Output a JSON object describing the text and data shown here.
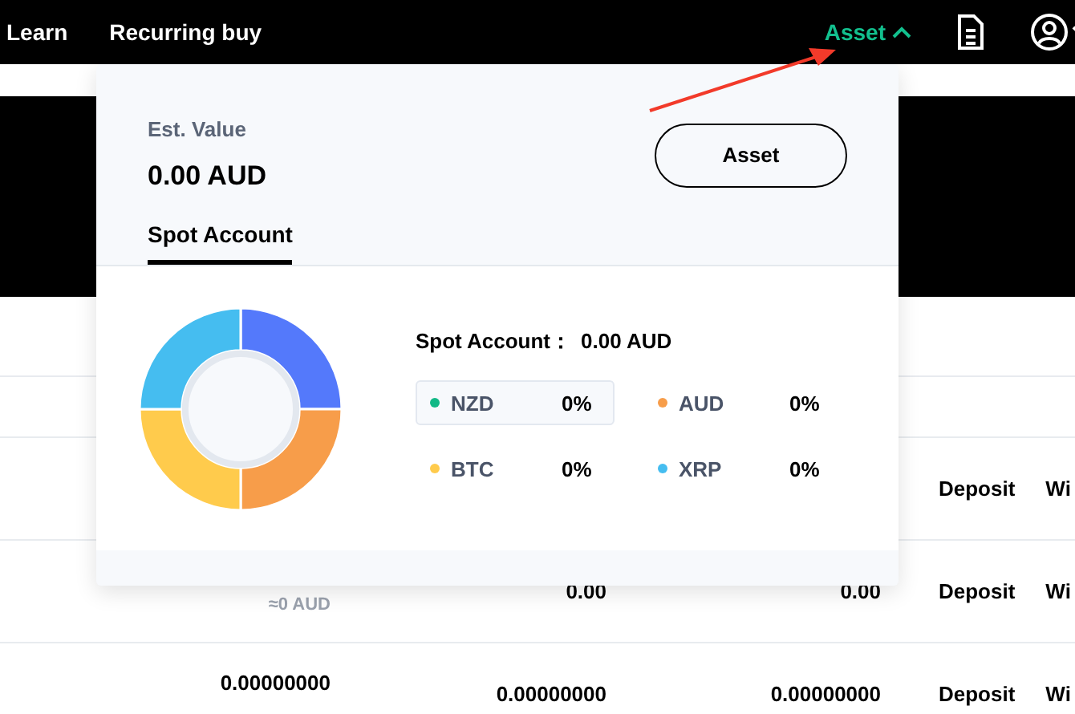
{
  "nav": {
    "items": [
      "Learn",
      "Recurring buy"
    ],
    "asset_menu": {
      "label": "Asset",
      "expanded": true
    }
  },
  "table": {
    "rows": [
      {
        "balance": null,
        "approx": null,
        "column_3": null,
        "column_4": null,
        "actions": [
          "Deposit",
          "Wi"
        ]
      },
      {
        "balance": null,
        "approx": "≈0 AUD",
        "column_3": "0.00",
        "column_4": "0.00",
        "actions": [
          "Deposit",
          "Wi"
        ]
      },
      {
        "balance": "0.00000000",
        "approx": null,
        "column_3": "0.00000000",
        "column_4": "0.00000000",
        "actions": [
          "Deposit",
          "Wi"
        ]
      }
    ]
  },
  "asset_dropdown": {
    "est_label": "Est. Value",
    "est_value": "0.00 AUD",
    "button": "Asset",
    "tabs": [
      {
        "label": "Spot Account",
        "selected": true
      }
    ],
    "summary_label": "Spot Account：",
    "summary_value": "0.00 AUD",
    "legend": [
      {
        "name": "NZD",
        "percent": "0%",
        "color": "#12b886",
        "selected": true
      },
      {
        "name": "AUD",
        "percent": "0%",
        "color": "#f79d4a",
        "selected": false
      },
      {
        "name": "BTC",
        "percent": "0%",
        "color": "#ffcb4c",
        "selected": false
      },
      {
        "name": "XRP",
        "percent": "0%",
        "color": "#45bdf0",
        "selected": false
      }
    ]
  }
}
